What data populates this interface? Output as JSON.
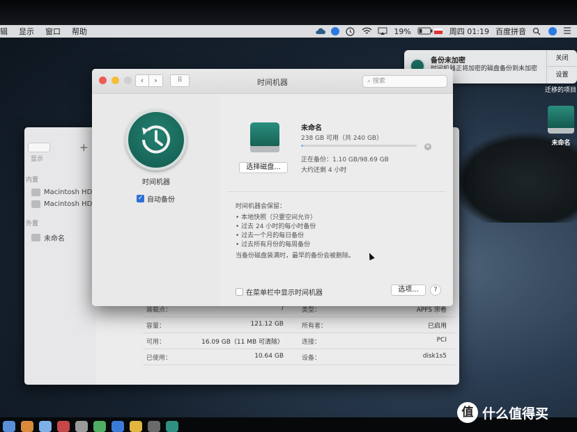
{
  "menubar": {
    "items": [
      "辑",
      "显示",
      "窗口",
      "帮助"
    ],
    "battery": "19%",
    "clock": "周四 01:19",
    "ime": "百度拼音"
  },
  "notification": {
    "title": "备份未加密",
    "message": "时间机器正将加密的磁盘备份到未加密的磁盘。",
    "close_label": "关闭",
    "settings_label": "设置"
  },
  "desktop": {
    "cut_text": "迁移的项目",
    "drive_label": "未命名"
  },
  "finder": {
    "view_label": "显示",
    "sections": [
      {
        "title": "内置",
        "items": [
          "Macintosh HD",
          "Macintosh HD"
        ]
      },
      {
        "title": "外置",
        "items": [
          "未命名"
        ]
      }
    ],
    "info_rows": [
      {
        "lk": "装载点：",
        "lv": "/",
        "rk": "类型：",
        "rv": "APFS 宗卷"
      },
      {
        "lk": "容量：",
        "lv": "121.12 GB",
        "rk": "所有者：",
        "rv": "已启用"
      },
      {
        "lk": "可用：",
        "lv": "16.09 GB（11 MB 可清除）",
        "rk": "连接：",
        "rv": "PCI"
      },
      {
        "lk": "已使用：",
        "lv": "10.64 GB",
        "rk": "设备：",
        "rv": "disk1s5"
      }
    ]
  },
  "timemachine": {
    "window_title": "时间机器",
    "search_placeholder": "搜索",
    "app_name": "时间机器",
    "auto_backup_label": "自动备份",
    "auto_backup_checked": true,
    "disk_name": "未命名",
    "disk_size": "238 GB 可用（共 240 GB）",
    "backup_progress": 0.011,
    "status": "正在备份：1.10 GB/98.69 GB",
    "remaining": "大约还剩 4 小时",
    "select_disk_button": "选择磁盘...",
    "keeps_title": "时间机器会保留：",
    "keeps": [
      "本地快照（只要空间允许）",
      "过去 24 小时的每小时备份",
      "过去一个月的每日备份",
      "过去所有月份的每周备份"
    ],
    "full_note": "当备份磁盘装满时，最早的备份会被删除。",
    "show_in_menubar_label": "在菜单栏中显示时间机器",
    "options_button": "选项...",
    "help_button": "?"
  },
  "watermark": {
    "logo": "值",
    "text": "什么值得买"
  },
  "colors": {
    "accent": "#2d6fd6",
    "tm_teal": "#1b6c62"
  }
}
